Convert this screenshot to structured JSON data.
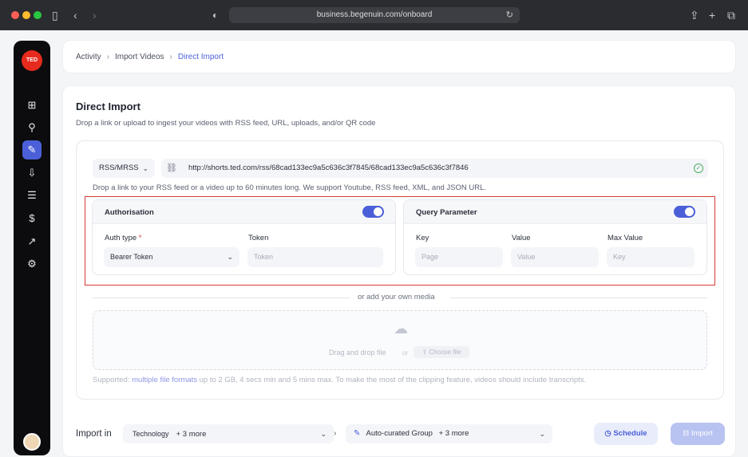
{
  "browser": {
    "url": "business.begenuin.com/onboard",
    "traffic_lights": [
      "#ff5f57",
      "#febc2e",
      "#28c840"
    ]
  },
  "sidebar": {
    "logo": "TED",
    "items": [
      {
        "icon": "grid-icon",
        "glyph": "⊞",
        "active": false
      },
      {
        "icon": "network-icon",
        "glyph": "⚲",
        "active": false
      },
      {
        "icon": "magic-wand-icon",
        "glyph": "✎",
        "active": true
      },
      {
        "icon": "import-icon",
        "glyph": "⇩",
        "active": false
      },
      {
        "icon": "checklist-icon",
        "glyph": "☰",
        "active": false
      },
      {
        "icon": "dollar-icon",
        "glyph": "$",
        "active": false
      },
      {
        "icon": "analytics-icon",
        "glyph": "↗",
        "active": false
      },
      {
        "icon": "settings-icon",
        "glyph": "⚙",
        "active": false
      }
    ]
  },
  "breadcrumb": {
    "items": [
      "Activity",
      "Import Videos",
      "Direct Import"
    ]
  },
  "main": {
    "title": "Direct Import",
    "subtitle": "Drop a link or upload to ingest your videos with RSS feed, URL, uploads, and/or QR code",
    "source_type": "RSS/MRSS",
    "url_value": "http://shorts.ted.com/rss/68cad133ec9a5c636c3f7845/68cad133ec9a5c636c3f7846",
    "help_text": "Drop a link to your RSS feed or a video up to 60 minutes long. We support Youtube, RSS feed, XML, and JSON URL.",
    "auth": {
      "title": "Authorisation",
      "enabled": true,
      "auth_type_label": "Auth type",
      "required_mark": "*",
      "auth_type_value": "Bearer Token",
      "token_label": "Token",
      "token_placeholder": "Token"
    },
    "query": {
      "title": "Query Parameter",
      "enabled": true,
      "key_label": "Key",
      "value_label": "Value",
      "max_label": "Max Value",
      "key_placeholder": "Page",
      "value_placeholder": "Value",
      "max_placeholder": "Key"
    },
    "divider_text": "or add your own media",
    "dropzone": {
      "text": "Drag and drop file",
      "or": "or",
      "choose": "Choose file"
    },
    "supported": {
      "prefix": "Supported: ",
      "link": "multiple file formats",
      "suffix": " up to 2 GB, 4 secs min and 5 mins max. To make the most of the clipping feature, videos should include transcripts."
    }
  },
  "footer": {
    "import_in_label": "Import in",
    "category": "Technology",
    "category_more": "+ 3 more",
    "group": "Auto-curated Group",
    "group_more": "+ 3 more",
    "schedule_label": "Schedule",
    "import_label": "Import"
  },
  "colors": {
    "accent": "#4b5fd8",
    "highlight_border": "#d63a3a",
    "success": "#4bb063"
  }
}
